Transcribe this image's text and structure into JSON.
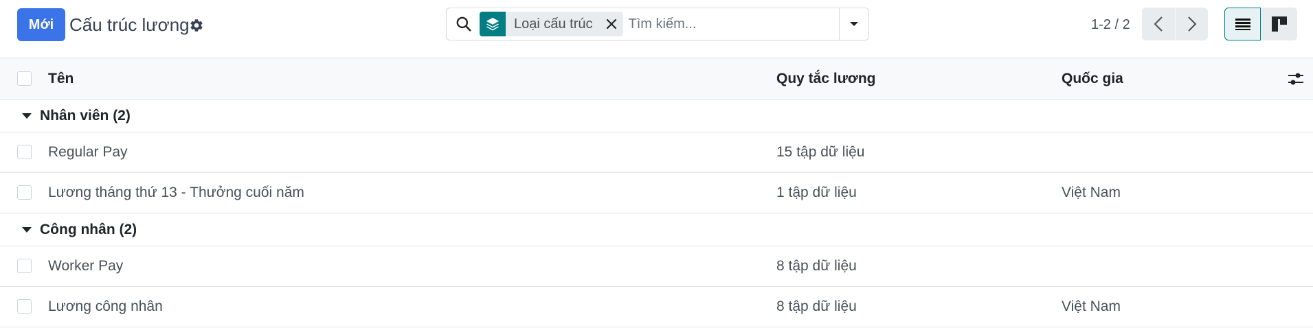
{
  "control_panel": {
    "new_button": "Mới",
    "title": "Cấu trúc lương",
    "settings_icon": "gear-icon"
  },
  "search": {
    "facet_icon": "layers-icon",
    "facet_label": "Loại cấu trúc",
    "placeholder": "Tìm kiếm..."
  },
  "pager": {
    "value": "1-2 / 2"
  },
  "views": {
    "active": "list"
  },
  "table": {
    "headers": {
      "name": "Tên",
      "rules": "Quy tắc lương",
      "country": "Quốc gia"
    },
    "groups": [
      {
        "label": "Nhân viên (2)",
        "rows": [
          {
            "name": "Regular Pay",
            "rules": "15 tập dữ liệu",
            "country": ""
          },
          {
            "name": "Lương tháng thứ 13 - Thưởng cuối năm",
            "rules": "1 tập dữ liệu",
            "country": "Việt Nam"
          }
        ]
      },
      {
        "label": "Công nhân (2)",
        "rows": [
          {
            "name": "Worker Pay",
            "rules": "8 tập dữ liệu",
            "country": ""
          },
          {
            "name": "Lương công nhân",
            "rules": "8 tập dữ liệu",
            "country": "Việt Nam"
          }
        ]
      }
    ]
  },
  "colors": {
    "primary": "#3b73e8",
    "teal": "#017e84",
    "header_bg": "#f8f9fa",
    "border": "#dee2e6"
  }
}
